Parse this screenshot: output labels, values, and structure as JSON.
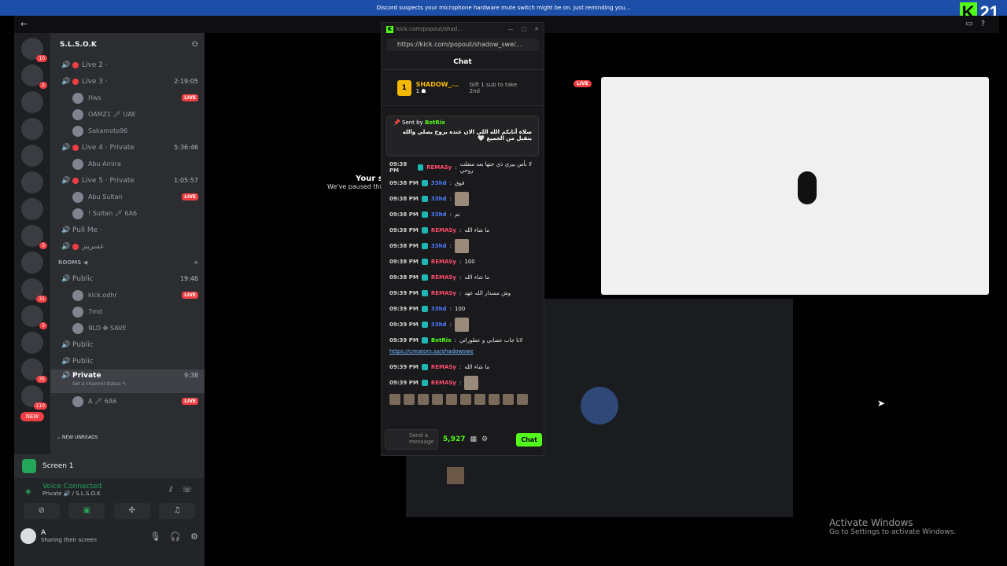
{
  "notice": "Discord suspects your microphone hardware mute switch might be on. Just reminding you...",
  "kick_overlay": {
    "logo": "K",
    "count": "21"
  },
  "server_badges": [
    "10",
    "2",
    "",
    "",
    "",
    "",
    "",
    "3",
    "",
    "31",
    "3",
    "",
    "35",
    "110"
  ],
  "server_new": "NEW",
  "server_name": "S.L.S.O.K",
  "channels": [
    {
      "name": "Live 2 ·",
      "time": ""
    },
    {
      "name": "Live 3 ·",
      "time": "2:19:05"
    }
  ],
  "members_live3": [
    {
      "name": "Hws",
      "live": "LIVE"
    },
    {
      "name": "OAMZ1 🗡 UAE",
      "live": ""
    },
    {
      "name": "Sakamoto96",
      "live": ""
    }
  ],
  "ch_live4": {
    "name": "Live 4 · Private",
    "time": "5:36:46"
  },
  "member_live4": "Abu Amira",
  "ch_live5": {
    "name": "Live 5 · Private",
    "time": "1:05:57"
  },
  "members_live5": [
    {
      "name": "Abu Sultan",
      "live": "LIVE"
    },
    {
      "name": "! Sultan 🗡 6A6",
      "live": ""
    }
  ],
  "ch_pull": "Pull Me ·",
  "ch_sub": "عسرينز",
  "category": "ROOMS ◀",
  "ch_public1": {
    "name": "Public",
    "time": "19:46"
  },
  "members_public": [
    {
      "name": "kick.odhr",
      "live": "LIVE"
    },
    {
      "name": "7md",
      "live": ""
    },
    {
      "name": "ЯLD ✤ SAVE",
      "live": ""
    }
  ],
  "ch_public2": "Public",
  "ch_public3": "Public",
  "ch_private": {
    "name": "Private",
    "time": "9:38",
    "status": "Set a channel status ✎"
  },
  "member_private": {
    "name": "A 🗡 6A6",
    "live": "LIVE"
  },
  "new_unreads": "⌄ NEW UNREADS",
  "screen": "Screen 1",
  "voice": {
    "title": "Voice Connected",
    "sub": "Private 🔊 / S.L.S.O.K"
  },
  "user": {
    "name": "A",
    "status": "Sharing their screen"
  },
  "paused": {
    "t1": "Your st",
    "t2": "We've paused this"
  },
  "live_badge": "LIVE",
  "activate": {
    "l1": "Activate Windows",
    "l2": "Go to Settings to activate Windows."
  },
  "popup": {
    "title": "kick.com/popout/shad...",
    "url": "https://kick.com/popout/shadow_swe/...",
    "chat_title": "Chat",
    "leader": {
      "rank": "1",
      "name": "SHADOW_...",
      "sub": "1 ☗",
      "gift": "Gift 1 sub to take 2nd"
    },
    "pinned": {
      "sent": "Sent by",
      "by": "BotRix",
      "msg": "صلاة أتابكم الله اللي الان عنده يروح يصلي والله يتقبل من الجميع 🤍"
    },
    "messages": [
      {
        "time": "09:38 PM",
        "user": "REMASy",
        "color": "#ff4d6d",
        "text": "لا بأس بيري ذي جتها بعد منقلت روحي",
        "img": false
      },
      {
        "time": "09:38 PM",
        "user": "33hd",
        "color": "#4d7dff",
        "text": "فوق",
        "img": false
      },
      {
        "time": "09:38 PM",
        "user": "33hd",
        "color": "#4d7dff",
        "text": "",
        "img": true
      },
      {
        "time": "09:38 PM",
        "user": "33hd",
        "color": "#4d7dff",
        "text": "تم",
        "img": false
      },
      {
        "time": "09:38 PM",
        "user": "REMASy",
        "color": "#ff4d6d",
        "text": "ما شاء الله",
        "img": false
      },
      {
        "time": "09:38 PM",
        "user": "33hd",
        "color": "#4d7dff",
        "text": "",
        "img": true
      },
      {
        "time": "09:38 PM",
        "user": "REMASy",
        "color": "#ff4d6d",
        "text": "100",
        "img": false
      },
      {
        "time": "09:38 PM",
        "user": "REMASy",
        "color": "#ff4d6d",
        "text": "ما شاء الله",
        "img": false
      },
      {
        "time": "09:39 PM",
        "user": "REMASy",
        "color": "#ff4d6d",
        "text": "وش مسدار الله عهد",
        "img": false
      },
      {
        "time": "09:39 PM",
        "user": "33hd",
        "color": "#4d7dff",
        "text": "100",
        "img": false
      },
      {
        "time": "09:39 PM",
        "user": "33hd",
        "color": "#4d7dff",
        "text": "",
        "img": true
      },
      {
        "time": "09:39 PM",
        "user": "BotRix",
        "color": "#53fc18",
        "text": "لانا جاب عصابي و عطوراتي",
        "img": false
      }
    ],
    "link": "https://creators.sa/shadowswe",
    "messages2": [
      {
        "time": "09:39 PM",
        "user": "REMASy",
        "color": "#ff4d6d",
        "text": "ما شاء الله",
        "img": false
      },
      {
        "time": "09:39 PM",
        "user": "REMASy",
        "color": "#ff4d6d",
        "text": "",
        "img": true
      }
    ],
    "input": {
      "placeholder": "Send a message",
      "points": "5,927",
      "chat_button": "Chat"
    }
  }
}
